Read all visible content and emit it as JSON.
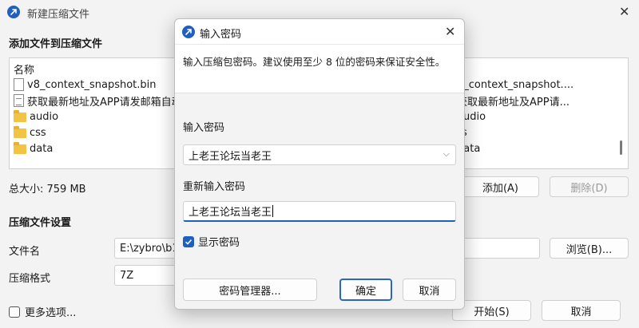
{
  "window": {
    "title": "新建压缩文件",
    "close_glyph": "✕"
  },
  "files_section": {
    "title": "添加文件到压缩文件",
    "column_header": "名称",
    "items": [
      {
        "name": "v8_context_snapshot.bin",
        "icon": "file-icon"
      },
      {
        "name": "获取最新地址及APP请发邮箱自动",
        "icon": "text-file-icon"
      },
      {
        "name": "audio",
        "icon": "folder-icon"
      },
      {
        "name": "css",
        "icon": "folder-icon"
      },
      {
        "name": "data",
        "icon": "folder-icon"
      }
    ],
    "right_items": [
      "8_context_snapshot....",
      "获取最新地址及APP请...",
      "audio",
      "s",
      "data"
    ],
    "total_size": "总大小: 759 MB",
    "add_button": "添加(A)",
    "delete_button": "删除(D)"
  },
  "settings_section": {
    "title": "压缩文件设置",
    "filename_label": "文件名",
    "filename_value": "E:\\zybro\\b1\\",
    "browse_button": "浏览(B)...",
    "format_label": "压缩格式",
    "format_value": "7Z"
  },
  "footer": {
    "more_options": "更多选项...",
    "start_button": "开始(S)",
    "cancel_button": "取消"
  },
  "dialog": {
    "title": "输入密码",
    "close_glyph": "✕",
    "hint": "输入压缩包密码。建议使用至少 8 位的密码来保证安全性。",
    "password_label": "输入密码",
    "password_value": "上老王论坛当老王",
    "confirm_label": "重新输入密码",
    "confirm_value": "上老王论坛当老王",
    "show_password_label": "显示密码",
    "show_password_checked": true,
    "manager_button": "密码管理器...",
    "ok_button": "确定",
    "cancel_button": "取消"
  },
  "colors": {
    "accent": "#1e5fbf",
    "background": "#f3f3f3",
    "folder": "#f3c343"
  }
}
